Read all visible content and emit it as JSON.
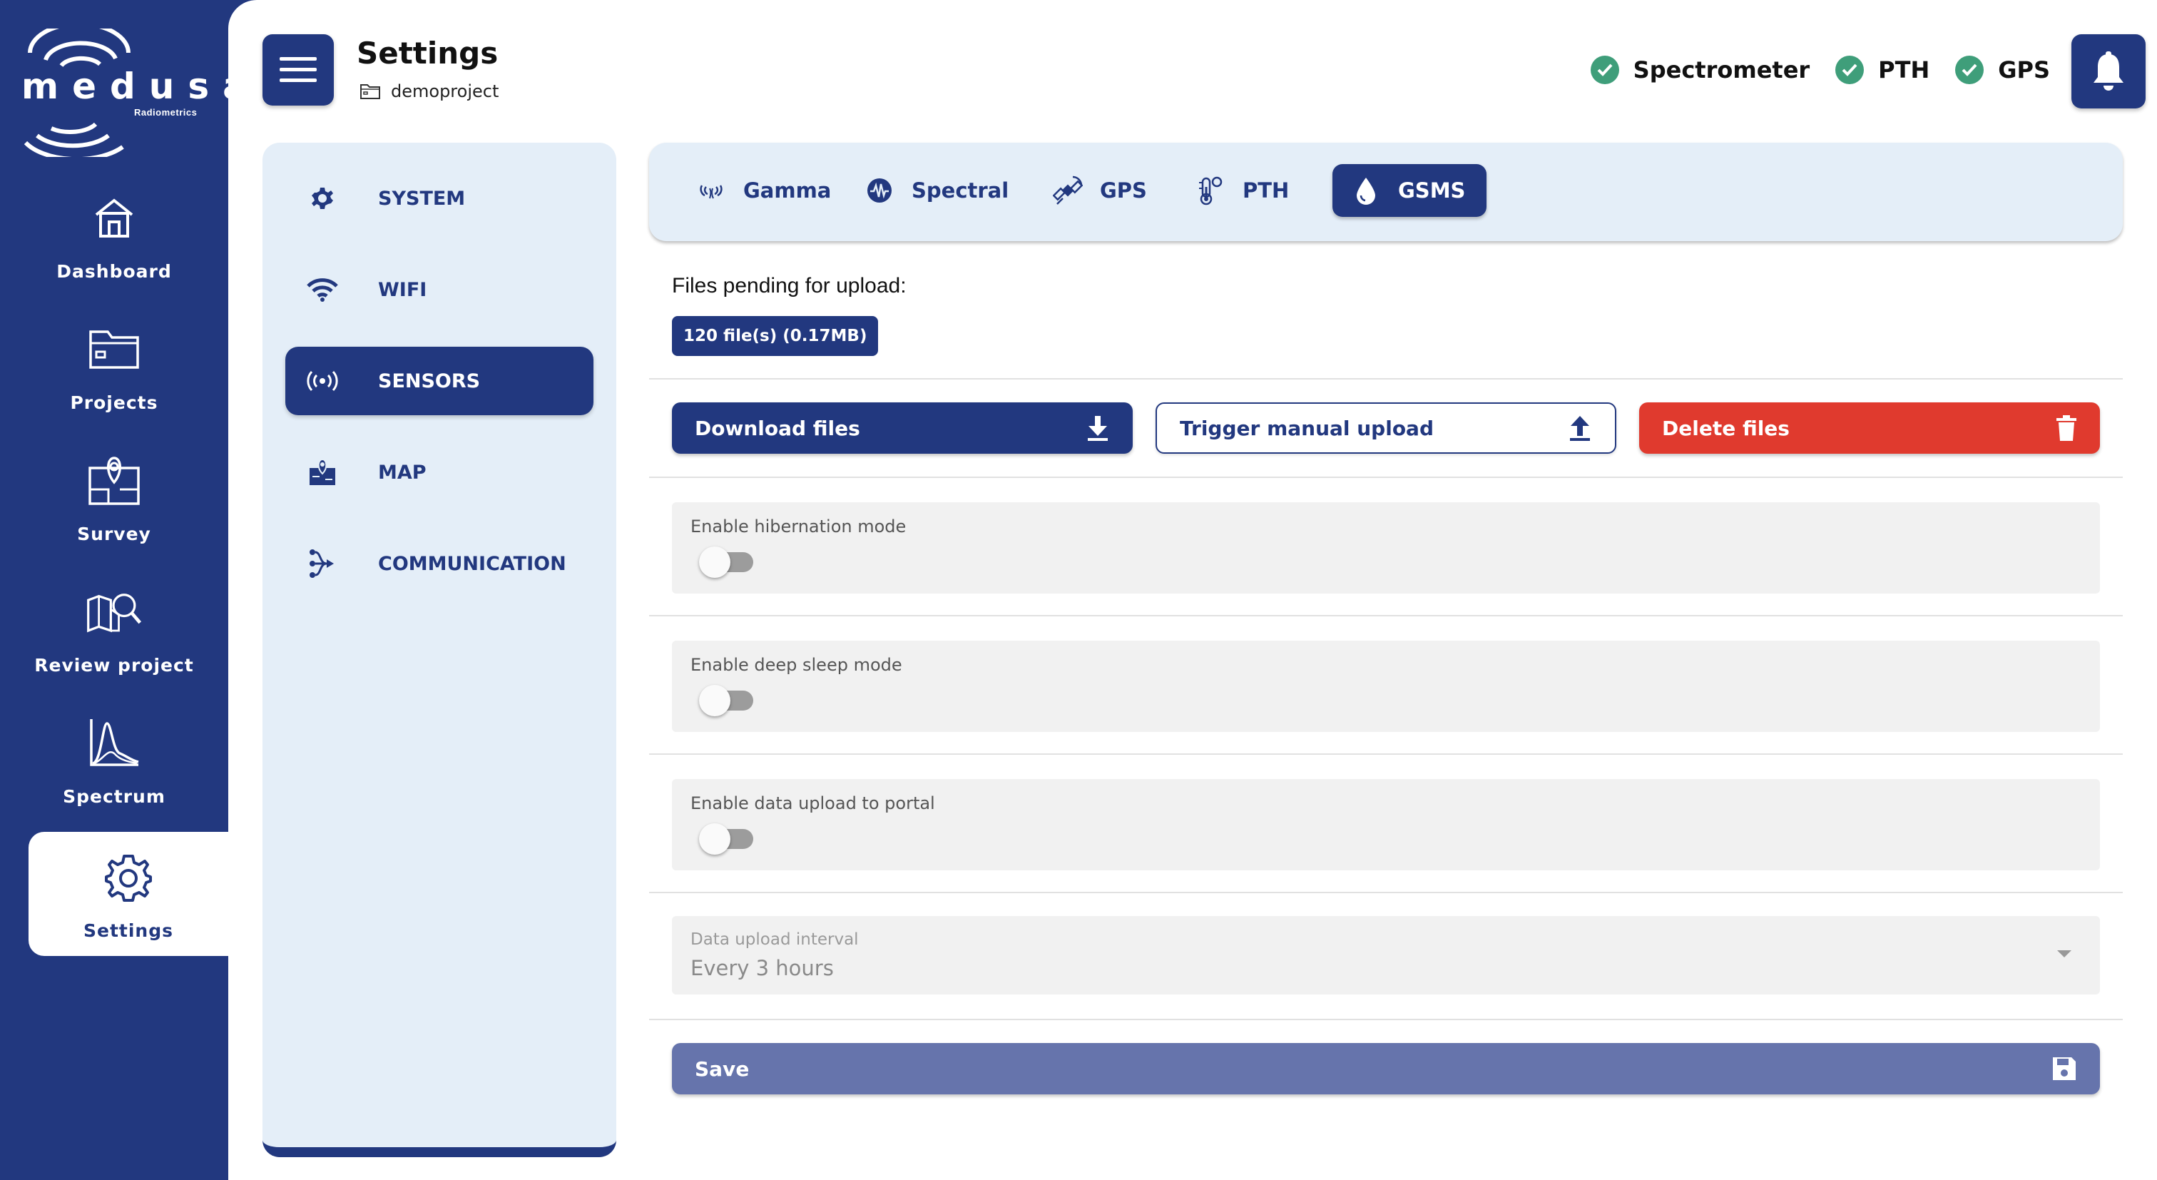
{
  "brand": {
    "name": "medusa",
    "subtitle": "Radiometrics",
    "logo_icon": "medusa-logo"
  },
  "nav": {
    "items": [
      {
        "label": "Dashboard",
        "icon": "house-icon"
      },
      {
        "label": "Projects",
        "icon": "folder-icon"
      },
      {
        "label": "Survey",
        "icon": "map-pin-icon"
      },
      {
        "label": "Review project",
        "icon": "map-search-icon"
      },
      {
        "label": "Spectrum",
        "icon": "spectrum-chart-icon"
      },
      {
        "label": "Settings",
        "icon": "gear-icon",
        "active": true
      }
    ]
  },
  "header": {
    "title": "Settings",
    "project": "demoproject",
    "menu_icon": "hamburger-icon",
    "bell_icon": "bell-icon",
    "statuses": [
      {
        "label": "Spectrometer",
        "ok": true
      },
      {
        "label": "PTH",
        "ok": true
      },
      {
        "label": "GPS",
        "ok": true
      }
    ]
  },
  "categories": [
    {
      "label": "SYSTEM",
      "icon": "gear-icon"
    },
    {
      "label": "WIFI",
      "icon": "wifi-icon"
    },
    {
      "label": "SENSORS",
      "icon": "sensor-icon",
      "active": true
    },
    {
      "label": "MAP",
      "icon": "map-icon"
    },
    {
      "label": "COMMUNICATION",
      "icon": "share-icon"
    }
  ],
  "tabs": [
    {
      "label": "Gamma",
      "icon": "gamma-icon"
    },
    {
      "label": "Spectral",
      "icon": "spectral-icon"
    },
    {
      "label": "GPS",
      "icon": "satellite-icon"
    },
    {
      "label": "PTH",
      "icon": "thermometer-icon"
    },
    {
      "label": "GSMS",
      "icon": "drop-icon",
      "active": true
    }
  ],
  "upload": {
    "pending_label": "Files pending for upload:",
    "pending_badge": "120 file(s) (0.17MB)"
  },
  "actions": {
    "download": "Download files",
    "trigger": "Trigger manual upload",
    "delete": "Delete files"
  },
  "toggles": [
    {
      "label": "Enable hibernation mode",
      "on": false
    },
    {
      "label": "Enable deep sleep mode",
      "on": false
    },
    {
      "label": "Enable data upload to portal",
      "on": false
    }
  ],
  "interval": {
    "label": "Data upload interval",
    "value": "Every 3 hours"
  },
  "save_label": "Save",
  "colors": {
    "primary": "#22387f",
    "panel": "#e4eef8",
    "danger": "#e03a2e",
    "ok": "#3f9e7a",
    "save": "#6674ac"
  }
}
